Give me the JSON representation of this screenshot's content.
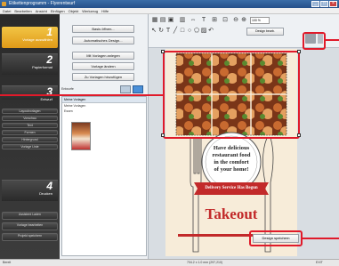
{
  "window": {
    "title": "Etikettenprogramm - Flyerentwurf"
  },
  "menu": [
    "Datei",
    "Bearbeiten",
    "Ansicht",
    "Einfügen",
    "Objekt",
    "Werkzeug",
    "Hilfe"
  ],
  "steps": [
    {
      "num": "1",
      "label": "Vorlage auswählen"
    },
    {
      "num": "2",
      "label": "Papierformat"
    },
    {
      "num": "3",
      "label": "Entwurf"
    },
    {
      "num": "4",
      "label": "Drucken"
    }
  ],
  "side_buttons": [
    "Layoutvorlagen",
    "Vorschau",
    "Text",
    "Formen",
    "Hintergrund",
    "Vorlage Liste"
  ],
  "side_bottom": [
    "Assistent Laden",
    "Vorlage bearbeiten",
    "Projekt speichern"
  ],
  "panel": {
    "btn_design": "Basis öffnen...",
    "btn_auto": "Automatisches Design...",
    "btn_layout": "Mit Vorlagen anlegen",
    "btn_reset": "Vorlage ändern",
    "btn_add": "Zu Vorlagen hinzufügen",
    "section": "Entwurfe",
    "list_header": "Meine Vorlagen",
    "list_items": [
      "Meine Vorlagen",
      "Essen"
    ]
  },
  "toolbar": {
    "zoom": "100 %",
    "design_btn": "Design bearb."
  },
  "flyer": {
    "line1": "Have delicious",
    "line2": "restaurant food",
    "line3": "in the comfort",
    "line4": "of your home!",
    "banner": "Delivery Service Has Begun",
    "title": "Takeout"
  },
  "save_button": "Design speichern",
  "status": {
    "left": "Bereit",
    "coords": "704.2 x 1.0 mm (297,210)",
    "right": "EXIT"
  }
}
